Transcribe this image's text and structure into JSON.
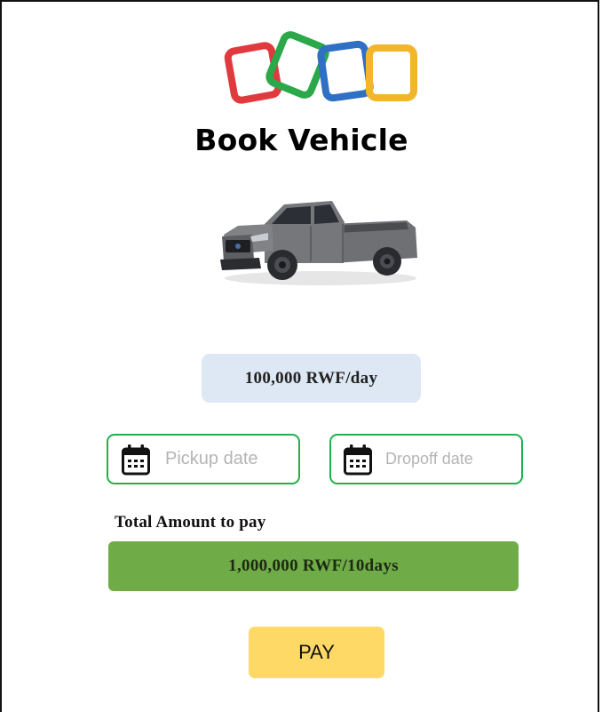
{
  "header": {
    "logo": {
      "icon": "zoho-style-logo-icon",
      "colors": [
        "#e03a3e",
        "#2aa84a",
        "#2f6fc4",
        "#f2b62c"
      ]
    },
    "title": "Book Vehicle"
  },
  "vehicle": {
    "image": "gray-pickup-truck-image",
    "price": "100,000 RWF/day"
  },
  "dates": {
    "pickup": {
      "placeholder": "Pickup date",
      "icon": "calendar-icon"
    },
    "dropoff": {
      "placeholder": "Dropoff date",
      "icon": "calendar-icon"
    }
  },
  "total": {
    "label": "Total Amount to pay",
    "amount": "1,000,000 RWF/10days"
  },
  "actions": {
    "pay_label": "PAY"
  },
  "colors": {
    "price_badge_bg": "#dde8f4",
    "date_border": "#22b04b",
    "total_bar_bg": "#6fab46",
    "pay_button_bg": "#ffd966"
  }
}
